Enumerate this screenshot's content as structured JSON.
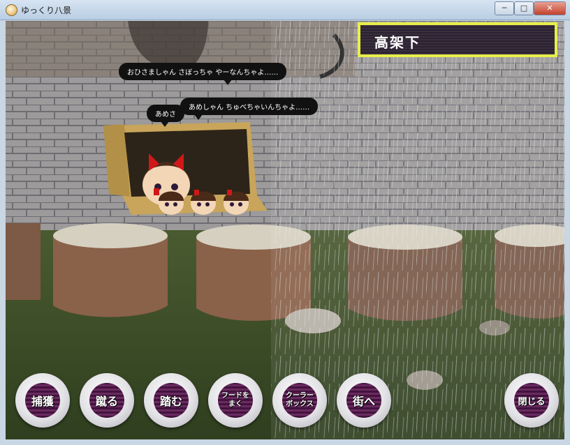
{
  "window": {
    "title": "ゆっくり八景",
    "minimize_label": "─",
    "maximize_label": "□",
    "close_label": "✕"
  },
  "location": {
    "name": "高架下"
  },
  "speech": [
    {
      "text": "おひさましゃん さぼっちゃ やーなんちゃよ……"
    },
    {
      "text": "あめしゃん ちゅべちゃいんちゃよ……"
    },
    {
      "text": "あめさ"
    }
  ],
  "actions": [
    {
      "label": "捕獲",
      "icon": "capture"
    },
    {
      "label": "蹴る",
      "icon": "kick"
    },
    {
      "label": "踏む",
      "icon": "stomp"
    },
    {
      "label": "フードを\nまく",
      "icon": "scatter-food"
    },
    {
      "label": "クーラー\nボックス",
      "icon": "cooler-box"
    },
    {
      "label": "街へ",
      "icon": "to-town"
    },
    {
      "label": "閉じる",
      "icon": "close"
    }
  ],
  "colors": {
    "location_border": "#e7ef4a",
    "button_core": "#5a2152"
  }
}
